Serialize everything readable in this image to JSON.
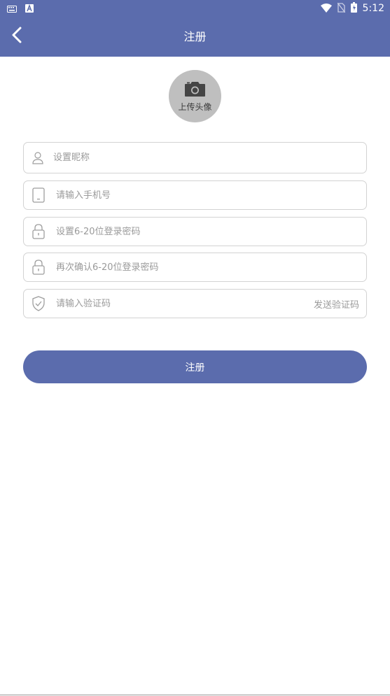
{
  "status_bar": {
    "time": "5:12",
    "icons": [
      "keyboard-icon",
      "a-notification-icon",
      "wifi-icon",
      "no-sim-icon",
      "battery-icon"
    ]
  },
  "header": {
    "title": "注册",
    "back_icon": "chevron-left-icon"
  },
  "avatar": {
    "label": "上传头像",
    "icon": "camera-icon"
  },
  "form": {
    "nickname": {
      "placeholder": "设置昵称",
      "icon": "user-icon"
    },
    "phone": {
      "placeholder": "请输入手机号",
      "icon": "phone-icon"
    },
    "password": {
      "placeholder": "设置6-20位登录密码",
      "icon": "lock-icon"
    },
    "confirm_password": {
      "placeholder": "再次确认6-20位登录密码",
      "icon": "lock-icon"
    },
    "code": {
      "placeholder": "请输入验证码",
      "icon": "shield-check-icon",
      "send_label": "发送验证码"
    }
  },
  "submit": {
    "label": "注册"
  },
  "colors": {
    "primary": "#5b6cad",
    "border": "#d3d3d3",
    "placeholder": "#9a9a9a"
  }
}
